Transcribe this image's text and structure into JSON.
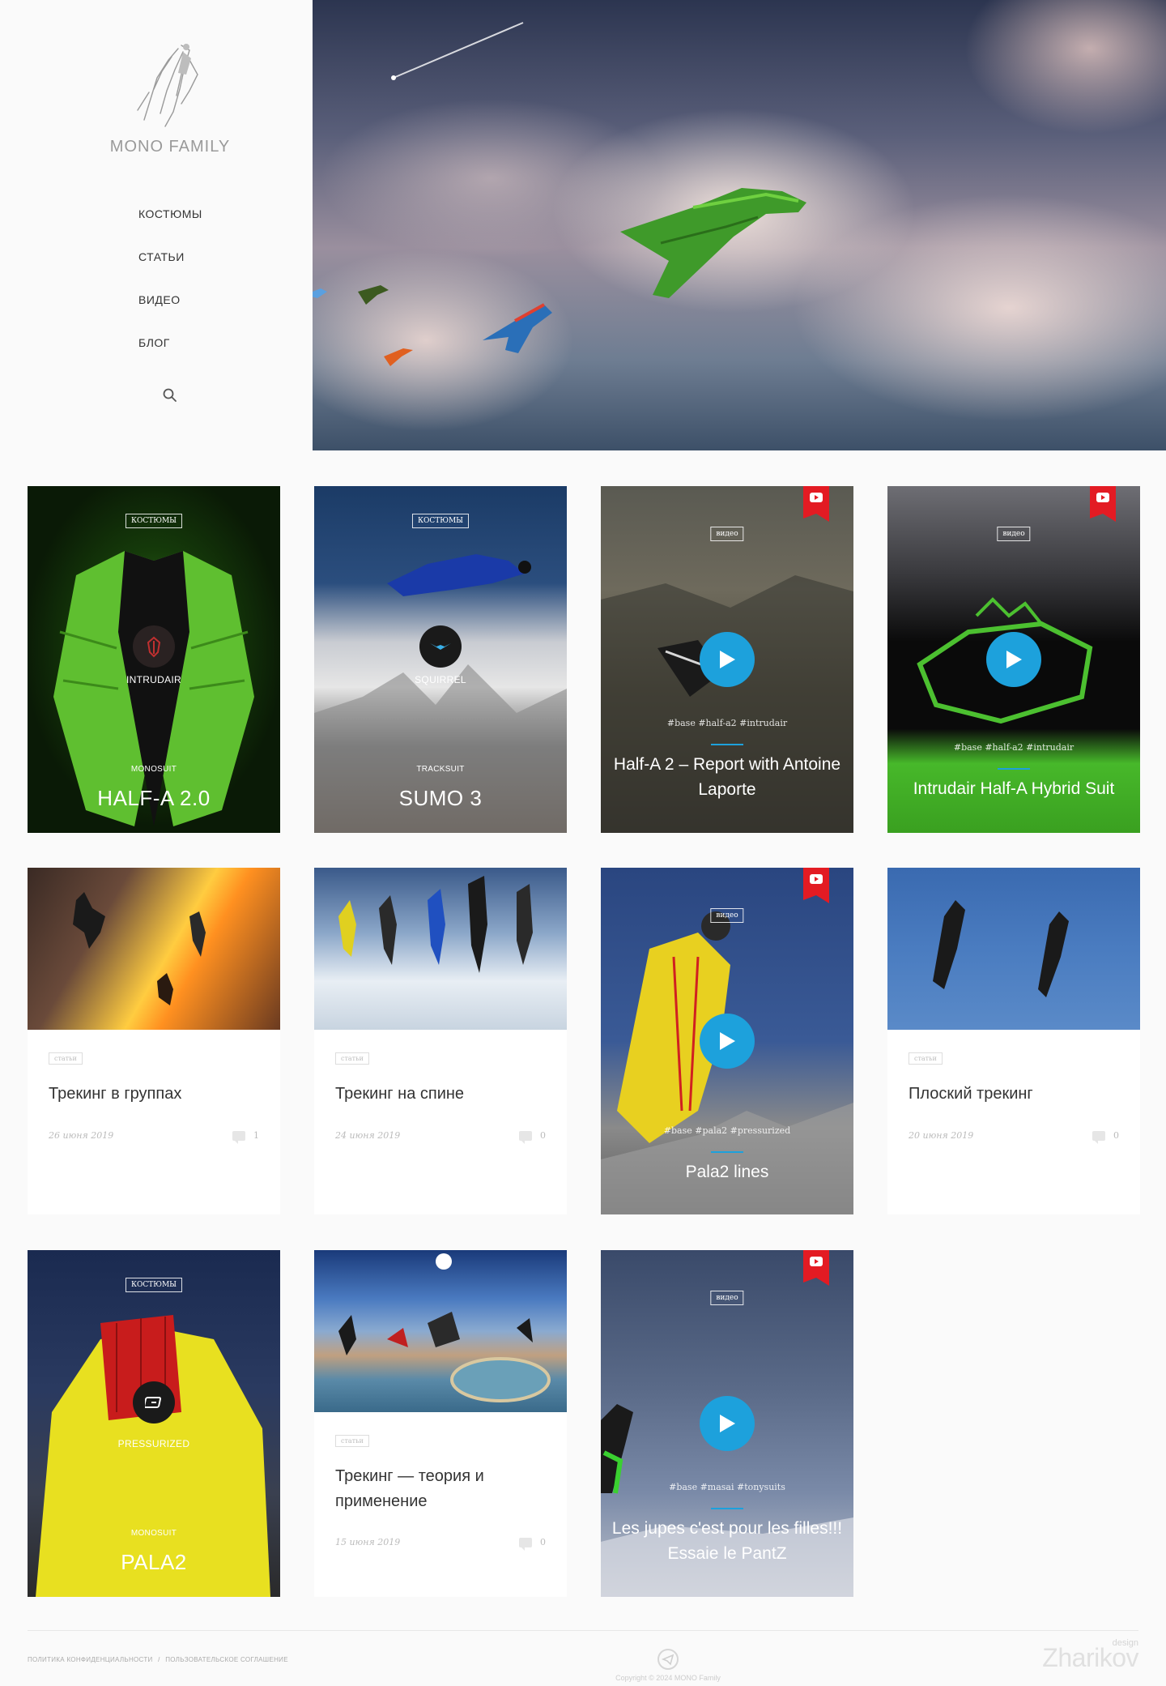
{
  "brand": {
    "name": "MONO FAMILY"
  },
  "nav": {
    "items": [
      {
        "label": "КОСТЮМЫ"
      },
      {
        "label": "СТАТЬИ"
      },
      {
        "label": "ВИДЕО"
      },
      {
        "label": "БЛОГ"
      }
    ],
    "search_icon": "search-icon"
  },
  "cards": [
    {
      "kind": "suit",
      "category": "КОСТЮМЫ",
      "brand": "INTRUDAIR",
      "suit_type": "MONOSUIT",
      "name": "HALF-A 2.0"
    },
    {
      "kind": "suit",
      "category": "КОСТЮМЫ",
      "brand": "SQUIRREL",
      "suit_type": "TRACKSUIT",
      "name": "SUMO 3"
    },
    {
      "kind": "video",
      "category": "видео",
      "tags": "#base #half-a2 #intrudair",
      "title": "Half-A 2 – Report with Antoine Laporte"
    },
    {
      "kind": "video",
      "category": "видео",
      "tags": "#base #half-a2 #intrudair",
      "title": "Intrudair Half-A Hybrid Suit"
    },
    {
      "kind": "article",
      "category": "статьи",
      "title": "Трекинг в группах",
      "date": "26 июня 2019",
      "comments": "1"
    },
    {
      "kind": "article",
      "category": "статьи",
      "title": "Трекинг на спине",
      "date": "24 июня 2019",
      "comments": "0"
    },
    {
      "kind": "video",
      "category": "видео",
      "tags": "#base #pala2 #pressurized",
      "title": "Pala2 lines"
    },
    {
      "kind": "article",
      "category": "статьи",
      "title": "Плоский трекинг",
      "date": "20 июня 2019",
      "comments": "0"
    },
    {
      "kind": "suit",
      "category": "КОСТЮМЫ",
      "brand": "PRESSURIZED",
      "suit_type": "MONOSUIT",
      "name": "PALA2"
    },
    {
      "kind": "article",
      "category": "статьи",
      "title": "Трекинг — теория и применение",
      "date": "15 июня 2019",
      "comments": "0"
    },
    {
      "kind": "video",
      "category": "видео",
      "tags": "#base #masai #tonysuits",
      "title": "Les jupes c'est pour les filles!!! Essaie le PantZ"
    }
  ],
  "footer": {
    "privacy": "ПОЛИТИКА КОНФИДЕНЦИАЛЬНОСТИ",
    "separator": "/",
    "agreement": "ПОЛЬЗОВАТЕЛЬСКОЕ СОГЛАШЕНИЕ",
    "copyright": "Copyright © 2024 MONO Family",
    "designer": "Zharikov",
    "designer_sub": "design"
  },
  "colors": {
    "accent": "#1da1dc",
    "youtube": "#e31b23"
  }
}
